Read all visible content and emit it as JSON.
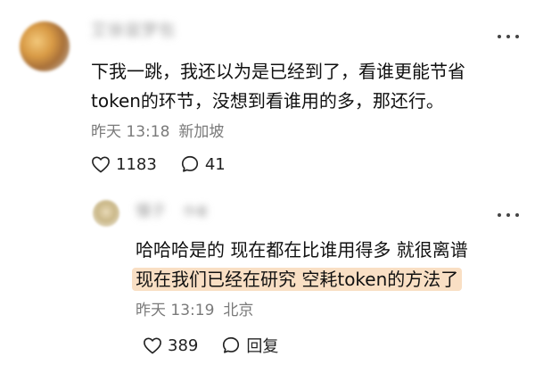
{
  "main_comment": {
    "username": "艾徐鼠梦包",
    "text_line1": "下我一跳，我还以为是已经到了，看谁更能节省",
    "text_line2": "token的环节，没想到看谁用的多，那还行。",
    "time": "昨天 13:18",
    "location": "新加坡",
    "like_count": "1183",
    "comment_count": "41"
  },
  "reply": {
    "username": "慢子",
    "tag": "作者",
    "text_line1": "哈哈哈是的 现在都在比谁用得多 就很离谱",
    "text_line2": "现在我们已经在研究 空耗token的方法了",
    "time": "昨天 13:19",
    "location": "北京",
    "like_count": "389",
    "reply_label": "回复"
  },
  "colors": {
    "highlight": "#f9dfc4",
    "meta_text": "#7a7a7a",
    "body_text": "#111111"
  },
  "icons": [
    "heart-icon",
    "comment-icon",
    "more-icon"
  ]
}
